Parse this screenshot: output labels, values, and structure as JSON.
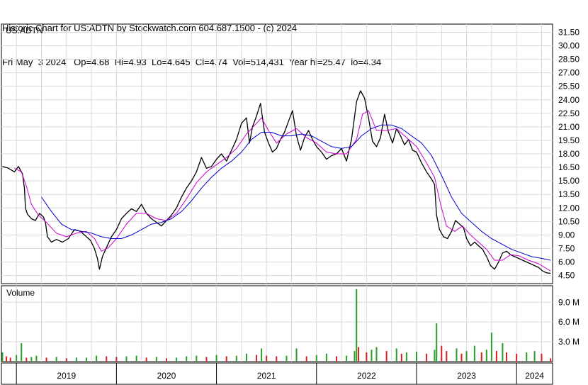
{
  "header": {
    "line1": "Historic Chart for US:ADTN by Stockwatch.com 604.687.1500 - (c) 2024",
    "line2": "Fri May  3 2024   Op=4.68  Hi=4.93  Lo=4.645  Cl=4.74  Vol=514,431  Year hi=25.47  lo=4.34"
  },
  "chart_data": {
    "type": "line",
    "symbol_label": "US:ADTN",
    "price_axis": {
      "ticks": [
        "31.50",
        "30.00",
        "28.50",
        "27.00",
        "25.50",
        "24.00",
        "22.50",
        "21.00",
        "19.50",
        "18.00",
        "16.50",
        "15.00",
        "13.50",
        "12.00",
        "10.50",
        "9.00",
        "7.50",
        "6.00",
        "4.50"
      ],
      "range": [
        3.6,
        32.4
      ]
    },
    "volume_panel": {
      "label": "Volume",
      "ticks": [
        "9.0 M",
        "6.0 M",
        "3.0 M"
      ],
      "range_millions": [
        0,
        11.5
      ]
    },
    "x_axis": {
      "years": [
        "2019",
        "2020",
        "2021",
        "2022",
        "2023",
        "2024"
      ],
      "range": [
        2018.85,
        2024.36
      ]
    },
    "series": [
      {
        "color": "#000000",
        "role": "price",
        "points": [
          [
            2018.86,
            16.6
          ],
          [
            2018.92,
            16.4
          ],
          [
            2018.98,
            16.0
          ],
          [
            2019.02,
            16.6
          ],
          [
            2019.06,
            15.8
          ],
          [
            2019.08,
            14.2
          ],
          [
            2019.09,
            12.0
          ],
          [
            2019.11,
            11.3
          ],
          [
            2019.15,
            10.8
          ],
          [
            2019.19,
            10.6
          ],
          [
            2019.23,
            11.4
          ],
          [
            2019.27,
            11.0
          ],
          [
            2019.29,
            10.4
          ],
          [
            2019.31,
            8.8
          ],
          [
            2019.35,
            8.2
          ],
          [
            2019.4,
            8.5
          ],
          [
            2019.46,
            8.2
          ],
          [
            2019.52,
            8.6
          ],
          [
            2019.58,
            9.6
          ],
          [
            2019.64,
            9.4
          ],
          [
            2019.7,
            8.8
          ],
          [
            2019.74,
            8.4
          ],
          [
            2019.78,
            7.5
          ],
          [
            2019.81,
            6.4
          ],
          [
            2019.83,
            5.2
          ],
          [
            2019.86,
            6.6
          ],
          [
            2019.9,
            7.6
          ],
          [
            2019.95,
            8.8
          ],
          [
            2020.0,
            9.6
          ],
          [
            2020.05,
            10.8
          ],
          [
            2020.1,
            11.4
          ],
          [
            2020.15,
            11.9
          ],
          [
            2020.2,
            11.6
          ],
          [
            2020.25,
            12.4
          ],
          [
            2020.3,
            11.4
          ],
          [
            2020.35,
            10.8
          ],
          [
            2020.4,
            10.4
          ],
          [
            2020.45,
            10.0
          ],
          [
            2020.5,
            10.6
          ],
          [
            2020.55,
            11.2
          ],
          [
            2020.6,
            12.0
          ],
          [
            2020.65,
            13.2
          ],
          [
            2020.7,
            14.2
          ],
          [
            2020.75,
            15.0
          ],
          [
            2020.8,
            16.0
          ],
          [
            2020.85,
            17.6
          ],
          [
            2020.9,
            16.4
          ],
          [
            2020.95,
            16.6
          ],
          [
            2021.0,
            17.4
          ],
          [
            2021.05,
            18.0
          ],
          [
            2021.1,
            17.2
          ],
          [
            2021.15,
            18.4
          ],
          [
            2021.2,
            19.6
          ],
          [
            2021.25,
            21.4
          ],
          [
            2021.3,
            22.0
          ],
          [
            2021.33,
            19.2
          ],
          [
            2021.36,
            21.0
          ],
          [
            2021.4,
            22.2
          ],
          [
            2021.44,
            23.6
          ],
          [
            2021.48,
            20.4
          ],
          [
            2021.52,
            19.2
          ],
          [
            2021.56,
            18.2
          ],
          [
            2021.6,
            18.6
          ],
          [
            2021.64,
            19.6
          ],
          [
            2021.68,
            20.4
          ],
          [
            2021.72,
            21.6
          ],
          [
            2021.76,
            22.8
          ],
          [
            2021.8,
            20.0
          ],
          [
            2021.84,
            18.4
          ],
          [
            2021.88,
            19.8
          ],
          [
            2021.92,
            20.6
          ],
          [
            2021.96,
            19.6
          ],
          [
            2022.0,
            18.8
          ],
          [
            2022.05,
            18.2
          ],
          [
            2022.1,
            17.4
          ],
          [
            2022.15,
            17.8
          ],
          [
            2022.2,
            18.0
          ],
          [
            2022.25,
            18.6
          ],
          [
            2022.3,
            17.2
          ],
          [
            2022.35,
            19.6
          ],
          [
            2022.4,
            23.8
          ],
          [
            2022.44,
            25.0
          ],
          [
            2022.48,
            24.2
          ],
          [
            2022.52,
            22.0
          ],
          [
            2022.56,
            19.4
          ],
          [
            2022.6,
            18.8
          ],
          [
            2022.64,
            19.8
          ],
          [
            2022.68,
            22.4
          ],
          [
            2022.72,
            20.4
          ],
          [
            2022.76,
            19.2
          ],
          [
            2022.8,
            20.8
          ],
          [
            2022.84,
            20.0
          ],
          [
            2022.88,
            19.0
          ],
          [
            2022.92,
            19.6
          ],
          [
            2022.96,
            18.4
          ],
          [
            2023.0,
            18.2
          ],
          [
            2023.05,
            17.0
          ],
          [
            2023.1,
            16.0
          ],
          [
            2023.15,
            15.2
          ],
          [
            2023.18,
            14.6
          ],
          [
            2023.2,
            11.2
          ],
          [
            2023.23,
            9.6
          ],
          [
            2023.27,
            8.8
          ],
          [
            2023.31,
            8.6
          ],
          [
            2023.35,
            9.4
          ],
          [
            2023.39,
            10.6
          ],
          [
            2023.43,
            10.2
          ],
          [
            2023.47,
            9.8
          ],
          [
            2023.5,
            8.6
          ],
          [
            2023.54,
            7.8
          ],
          [
            2023.58,
            8.2
          ],
          [
            2023.62,
            7.8
          ],
          [
            2023.66,
            7.4
          ],
          [
            2023.7,
            6.6
          ],
          [
            2023.74,
            5.6
          ],
          [
            2023.78,
            5.2
          ],
          [
            2023.82,
            6.0
          ],
          [
            2023.86,
            7.0
          ],
          [
            2023.9,
            7.2
          ],
          [
            2023.94,
            6.8
          ],
          [
            2023.98,
            6.6
          ],
          [
            2024.02,
            6.4
          ],
          [
            2024.06,
            6.2
          ],
          [
            2024.1,
            6.0
          ],
          [
            2024.14,
            5.8
          ],
          [
            2024.18,
            5.6
          ],
          [
            2024.22,
            5.4
          ],
          [
            2024.26,
            5.0
          ],
          [
            2024.3,
            4.8
          ],
          [
            2024.34,
            4.74
          ]
        ]
      },
      {
        "color": "#cc00cc",
        "role": "short moving average",
        "points": [
          [
            2018.98,
            16.4
          ],
          [
            2019.05,
            16.0
          ],
          [
            2019.1,
            14.4
          ],
          [
            2019.15,
            12.4
          ],
          [
            2019.22,
            11.2
          ],
          [
            2019.3,
            10.4
          ],
          [
            2019.4,
            9.2
          ],
          [
            2019.5,
            8.8
          ],
          [
            2019.6,
            9.2
          ],
          [
            2019.7,
            9.4
          ],
          [
            2019.78,
            8.6
          ],
          [
            2019.85,
            7.2
          ],
          [
            2019.92,
            7.6
          ],
          [
            2020.0,
            8.6
          ],
          [
            2020.1,
            10.2
          ],
          [
            2020.2,
            11.4
          ],
          [
            2020.3,
            11.4
          ],
          [
            2020.4,
            10.8
          ],
          [
            2020.5,
            10.6
          ],
          [
            2020.6,
            11.4
          ],
          [
            2020.7,
            13.0
          ],
          [
            2020.8,
            14.8
          ],
          [
            2020.9,
            16.0
          ],
          [
            2021.0,
            16.8
          ],
          [
            2021.1,
            17.6
          ],
          [
            2021.2,
            18.6
          ],
          [
            2021.3,
            20.2
          ],
          [
            2021.4,
            21.4
          ],
          [
            2021.45,
            22.0
          ],
          [
            2021.52,
            20.6
          ],
          [
            2021.6,
            19.2
          ],
          [
            2021.7,
            20.2
          ],
          [
            2021.8,
            20.8
          ],
          [
            2021.9,
            19.8
          ],
          [
            2022.0,
            19.2
          ],
          [
            2022.1,
            18.2
          ],
          [
            2022.2,
            18.0
          ],
          [
            2022.3,
            18.0
          ],
          [
            2022.4,
            19.6
          ],
          [
            2022.46,
            22.4
          ],
          [
            2022.52,
            22.8
          ],
          [
            2022.6,
            20.6
          ],
          [
            2022.7,
            20.6
          ],
          [
            2022.8,
            20.8
          ],
          [
            2022.9,
            19.8
          ],
          [
            2023.0,
            18.8
          ],
          [
            2023.1,
            17.0
          ],
          [
            2023.18,
            15.4
          ],
          [
            2023.24,
            12.4
          ],
          [
            2023.3,
            10.0
          ],
          [
            2023.38,
            9.4
          ],
          [
            2023.46,
            10.0
          ],
          [
            2023.54,
            9.0
          ],
          [
            2023.62,
            8.2
          ],
          [
            2023.7,
            7.4
          ],
          [
            2023.78,
            6.2
          ],
          [
            2023.86,
            6.2
          ],
          [
            2023.94,
            6.8
          ],
          [
            2024.02,
            6.7
          ],
          [
            2024.12,
            6.2
          ],
          [
            2024.22,
            5.8
          ],
          [
            2024.34,
            5.0
          ]
        ]
      },
      {
        "color": "#0000cc",
        "role": "long moving average",
        "points": [
          [
            2019.25,
            13.2
          ],
          [
            2019.35,
            11.6
          ],
          [
            2019.45,
            10.2
          ],
          [
            2019.55,
            9.6
          ],
          [
            2019.65,
            9.4
          ],
          [
            2019.75,
            9.2
          ],
          [
            2019.85,
            8.8
          ],
          [
            2019.95,
            8.6
          ],
          [
            2020.05,
            8.6
          ],
          [
            2020.15,
            9.0
          ],
          [
            2020.25,
            9.6
          ],
          [
            2020.35,
            10.2
          ],
          [
            2020.45,
            10.4
          ],
          [
            2020.55,
            10.8
          ],
          [
            2020.65,
            11.6
          ],
          [
            2020.75,
            12.8
          ],
          [
            2020.85,
            14.2
          ],
          [
            2020.95,
            15.4
          ],
          [
            2021.05,
            16.4
          ],
          [
            2021.15,
            17.2
          ],
          [
            2021.25,
            18.2
          ],
          [
            2021.35,
            19.6
          ],
          [
            2021.45,
            20.4
          ],
          [
            2021.55,
            20.4
          ],
          [
            2021.65,
            20.0
          ],
          [
            2021.75,
            20.0
          ],
          [
            2021.85,
            20.2
          ],
          [
            2021.95,
            20.0
          ],
          [
            2022.05,
            19.4
          ],
          [
            2022.15,
            18.8
          ],
          [
            2022.25,
            18.6
          ],
          [
            2022.35,
            18.8
          ],
          [
            2022.45,
            20.0
          ],
          [
            2022.55,
            20.8
          ],
          [
            2022.65,
            21.2
          ],
          [
            2022.75,
            21.2
          ],
          [
            2022.85,
            20.8
          ],
          [
            2022.95,
            20.0
          ],
          [
            2023.05,
            19.2
          ],
          [
            2023.15,
            17.8
          ],
          [
            2023.25,
            15.6
          ],
          [
            2023.35,
            13.2
          ],
          [
            2023.45,
            11.4
          ],
          [
            2023.55,
            10.4
          ],
          [
            2023.65,
            9.4
          ],
          [
            2023.75,
            8.6
          ],
          [
            2023.85,
            8.0
          ],
          [
            2023.95,
            7.4
          ],
          [
            2024.05,
            7.0
          ],
          [
            2024.15,
            6.6
          ],
          [
            2024.25,
            6.4
          ],
          [
            2024.34,
            6.2
          ]
        ]
      }
    ],
    "volume_millions": [
      [
        2018.86,
        1.4
      ],
      [
        2018.9,
        0.8
      ],
      [
        2018.94,
        0.6
      ],
      [
        2019.0,
        1.0
      ],
      [
        2019.05,
        2.8
      ],
      [
        2019.1,
        0.6
      ],
      [
        2019.15,
        0.7
      ],
      [
        2019.2,
        0.9
      ],
      [
        2019.3,
        0.6
      ],
      [
        2019.4,
        0.7
      ],
      [
        2019.5,
        0.5
      ],
      [
        2019.6,
        0.6
      ],
      [
        2019.7,
        0.6
      ],
      [
        2019.8,
        0.9
      ],
      [
        2019.9,
        0.8
      ],
      [
        2020.0,
        0.7
      ],
      [
        2020.1,
        0.8
      ],
      [
        2020.2,
        0.9
      ],
      [
        2020.3,
        0.6
      ],
      [
        2020.4,
        0.7
      ],
      [
        2020.5,
        0.5
      ],
      [
        2020.6,
        0.6
      ],
      [
        2020.7,
        0.8
      ],
      [
        2020.8,
        0.9
      ],
      [
        2020.9,
        0.7
      ],
      [
        2021.0,
        1.0
      ],
      [
        2021.1,
        0.8
      ],
      [
        2021.2,
        0.9
      ],
      [
        2021.3,
        1.2
      ],
      [
        2021.4,
        1.0
      ],
      [
        2021.45,
        2.0
      ],
      [
        2021.5,
        0.9
      ],
      [
        2021.6,
        0.8
      ],
      [
        2021.7,
        0.9
      ],
      [
        2021.8,
        2.0
      ],
      [
        2021.9,
        0.8
      ],
      [
        2022.0,
        1.0
      ],
      [
        2022.1,
        1.2
      ],
      [
        2022.2,
        0.8
      ],
      [
        2022.3,
        0.9
      ],
      [
        2022.38,
        1.6
      ],
      [
        2022.4,
        11.0
      ],
      [
        2022.42,
        2.2
      ],
      [
        2022.5,
        1.4
      ],
      [
        2022.55,
        1.8
      ],
      [
        2022.6,
        2.2
      ],
      [
        2022.7,
        1.6
      ],
      [
        2022.8,
        2.0
      ],
      [
        2022.85,
        1.2
      ],
      [
        2022.9,
        1.4
      ],
      [
        2023.0,
        1.5
      ],
      [
        2023.1,
        1.2
      ],
      [
        2023.18,
        1.8
      ],
      [
        2023.2,
        5.8
      ],
      [
        2023.25,
        2.4
      ],
      [
        2023.3,
        1.6
      ],
      [
        2023.4,
        2.0
      ],
      [
        2023.45,
        1.2
      ],
      [
        2023.5,
        1.6
      ],
      [
        2023.58,
        2.4
      ],
      [
        2023.65,
        1.4
      ],
      [
        2023.7,
        1.8
      ],
      [
        2023.75,
        4.4
      ],
      [
        2023.8,
        1.6
      ],
      [
        2023.86,
        2.8
      ],
      [
        2023.9,
        1.4
      ],
      [
        2024.0,
        1.2
      ],
      [
        2024.1,
        1.4
      ],
      [
        2024.18,
        1.6
      ],
      [
        2024.25,
        1.2
      ],
      [
        2024.34,
        0.5
      ]
    ]
  }
}
